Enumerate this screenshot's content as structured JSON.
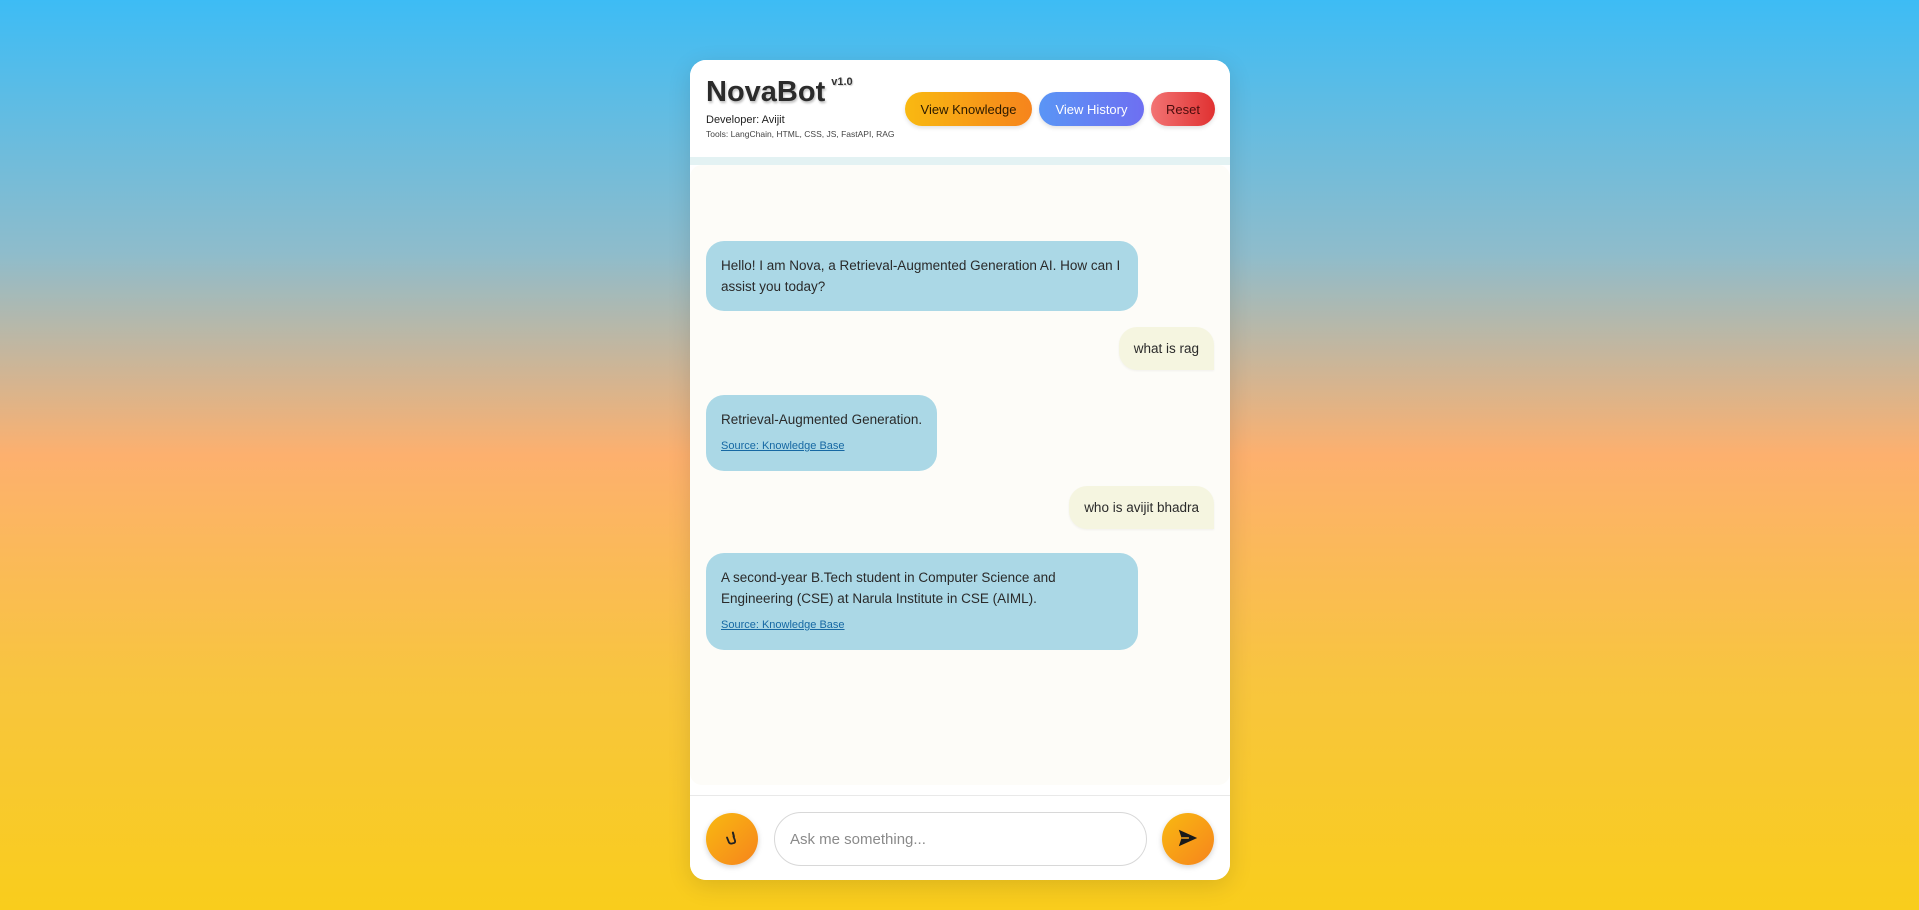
{
  "header": {
    "title": "NovaBot",
    "version": "v1.0",
    "developer": "Developer: Avijit",
    "tools": "Tools: LangChain, HTML, CSS, JS, FastAPI, RAG",
    "buttons": {
      "view_knowledge": "View Knowledge",
      "view_history": "View History",
      "reset": "Reset"
    }
  },
  "messages": [
    {
      "role": "bot",
      "text": "Hello! I am Nova, a Retrieval-Augmented Generation AI. How can I assist you today?"
    },
    {
      "role": "user",
      "text": "what is rag"
    },
    {
      "role": "bot",
      "text": "Retrieval-Augmented Generation.",
      "source": "Source: Knowledge Base"
    },
    {
      "role": "user",
      "text": "who is avijit bhadra"
    },
    {
      "role": "bot",
      "text": "A second-year B.Tech student in Computer Science and Engineering (CSE) at Narula Institute in CSE (AIML).",
      "source": "Source: Knowledge Base"
    }
  ],
  "input": {
    "placeholder": "Ask me something...",
    "value": ""
  },
  "icons": {
    "mic": "microphone-icon",
    "send": "send-icon"
  },
  "colors": {
    "bot_bubble": "#abd8e6",
    "user_bubble": "#f5f5e0",
    "accent": "#f6841c"
  }
}
